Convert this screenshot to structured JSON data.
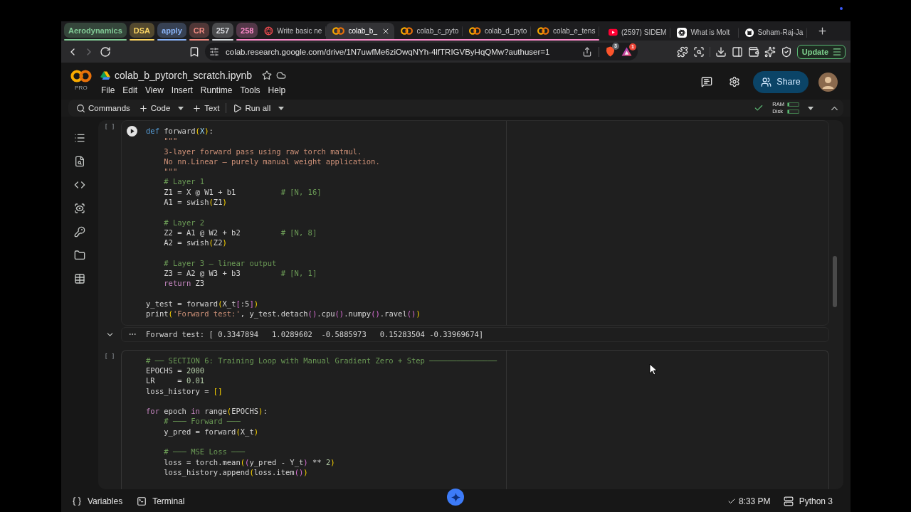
{
  "browser": {
    "tab_groups": [
      {
        "label": "Aerodynamics",
        "color": "#81c995"
      },
      {
        "label": "DSA",
        "color": "#fdd663"
      },
      {
        "label": "apply",
        "color": "#8ab4f8"
      },
      {
        "label": "CR",
        "color": "#f28b82"
      },
      {
        "label": "257",
        "color": "#dadce0"
      },
      {
        "label": "258",
        "color": "#ff8bcb",
        "tabs": [
          {
            "kind": "burst",
            "title": "Write basic ne",
            "selected": false
          },
          {
            "kind": "rings",
            "title": "colab_b_",
            "selected": true
          },
          {
            "kind": "rings",
            "title": "colab_c_pyto",
            "selected": false
          },
          {
            "kind": "rings",
            "title": "colab_d_pyto",
            "selected": false
          },
          {
            "kind": "rings",
            "title": "colab_e_tens",
            "selected": false
          }
        ]
      }
    ],
    "tabs": [
      {
        "kind": "play",
        "title": "(2597) SIDEM",
        "selected": false
      },
      {
        "kind": "knot",
        "title": "What is Molt",
        "selected": false
      },
      {
        "kind": "cat",
        "title": "Soham-Raj-Ja",
        "selected": false
      }
    ],
    "nav_buttons": [
      {
        "kind": "back",
        "disabled": false
      },
      {
        "kind": "forward",
        "disabled": true
      },
      {
        "kind": "reload",
        "disabled": false
      }
    ],
    "address": "colab.research.google.com/drive/1N7uwfMe6ziOwqNYh-4lfTRIGVByHqQMw?authuser=1",
    "extensions": [
      {
        "kind": "shield",
        "count": "3"
      },
      {
        "kind": "triangle",
        "count": "1"
      }
    ],
    "update_button": "Update"
  },
  "notebook": {
    "logo_badge": "PRO",
    "filename": "colab_b_pytorch_scratch.ipynb",
    "menu": [
      "File",
      "Edit",
      "View",
      "Insert",
      "Runtime",
      "Tools",
      "Help"
    ],
    "share_button": "Share",
    "toolbar": [
      {
        "kind": "search",
        "label": "Commands",
        "dropdown": false
      },
      {
        "kind": "add",
        "label": "Code",
        "dropdown": true
      },
      {
        "kind": "add",
        "label": "Text",
        "dropdown": false
      },
      {
        "kind": "run",
        "label": "Run all",
        "dropdown": true
      }
    ],
    "resources": {
      "connected": true,
      "meters": [
        {
          "label": "RAM",
          "level": 0.1
        },
        {
          "label": "Disk",
          "level": 0.1
        }
      ]
    },
    "cells": [
      {
        "prompt": "[ ]",
        "selected": true,
        "blocks": [
          {
            "lines": [
              [
                {
                  "kind": "keyword",
                  "text": "def"
                },
                {
                  "kind": "plain",
                  "text": " forward"
                },
                {
                  "kind": "paren",
                  "text": "("
                },
                {
                  "kind": "param",
                  "text": "X"
                },
                {
                  "kind": "paren",
                  "text": ")"
                },
                {
                  "kind": "plain",
                  "text": ":"
                }
              ],
              [
                {
                  "kind": "string",
                  "text": "    \"\"\""
                }
              ],
              [
                {
                  "kind": "string",
                  "text": "    3-layer forward pass using raw torch matmul."
                }
              ],
              [
                {
                  "kind": "string",
                  "text": "    No nn.Linear — purely manual weight application."
                }
              ],
              [
                {
                  "kind": "string",
                  "text": "    \"\"\""
                }
              ],
              [
                {
                  "kind": "comment",
                  "text": "    # Layer 1"
                }
              ],
              [
                {
                  "kind": "plain",
                  "text": "    Z1 = X @ W1 + b1          "
                },
                {
                  "kind": "comment",
                  "text": "# [N, 16]"
                }
              ],
              [
                {
                  "kind": "plain",
                  "text": "    A1 = swish"
                },
                {
                  "kind": "paren",
                  "text": "("
                },
                {
                  "kind": "plain",
                  "text": "Z1"
                },
                {
                  "kind": "paren",
                  "text": ")"
                }
              ]
            ]
          },
          {
            "lines": [
              [
                {
                  "kind": "comment",
                  "text": "    # Layer 2"
                }
              ],
              [
                {
                  "kind": "plain",
                  "text": "    Z2 = A1 @ W2 + b2         "
                },
                {
                  "kind": "comment",
                  "text": "# [N, 8]"
                }
              ],
              [
                {
                  "kind": "plain",
                  "text": "    A2 = swish"
                },
                {
                  "kind": "paren",
                  "text": "("
                },
                {
                  "kind": "plain",
                  "text": "Z2"
                },
                {
                  "kind": "paren",
                  "text": ")"
                }
              ]
            ]
          },
          {
            "lines": [
              [
                {
                  "kind": "comment",
                  "text": "    # Layer 3 — linear output"
                }
              ],
              [
                {
                  "kind": "plain",
                  "text": "    Z3 = A2 @ W3 + b3         "
                },
                {
                  "kind": "comment",
                  "text": "# [N, 1]"
                }
              ],
              [
                {
                  "kind": "control",
                  "text": "    return"
                },
                {
                  "kind": "plain",
                  "text": " Z3"
                }
              ]
            ]
          },
          {
            "lines": [
              [
                {
                  "kind": "plain",
                  "text": "y_test = forward"
                },
                {
                  "kind": "paren",
                  "text": "("
                },
                {
                  "kind": "plain",
                  "text": "X_t"
                },
                {
                  "kind": "bracket",
                  "text": "["
                },
                {
                  "kind": "plain",
                  "text": ":5"
                },
                {
                  "kind": "bracket",
                  "text": "]"
                },
                {
                  "kind": "paren",
                  "text": ")"
                }
              ],
              [
                {
                  "kind": "plain",
                  "text": "print"
                },
                {
                  "kind": "paren",
                  "text": "("
                },
                {
                  "kind": "string",
                  "text": "'Forward test:'"
                },
                {
                  "kind": "plain",
                  "text": ", y_test.detach"
                },
                {
                  "kind": "bracket",
                  "text": "()"
                },
                {
                  "kind": "plain",
                  "text": ".cpu"
                },
                {
                  "kind": "bracket",
                  "text": "()"
                },
                {
                  "kind": "plain",
                  "text": ".numpy"
                },
                {
                  "kind": "bracket",
                  "text": "()"
                },
                {
                  "kind": "plain",
                  "text": ".ravel"
                },
                {
                  "kind": "bracket",
                  "text": "()"
                },
                {
                  "kind": "paren",
                  "text": ")"
                }
              ]
            ]
          }
        ],
        "output": "Forward test: [ 0.3347894   1.0289602  -0.5885973   0.15283504 -0.33969674]"
      },
      {
        "prompt": "[ ]",
        "selected": false,
        "blocks": [
          {
            "lines": [
              [
                {
                  "kind": "comment",
                  "text": "# ── SECTION 6: Training Loop with Manual Gradient Zero + Step ───────────────"
                }
              ],
              [
                {
                  "kind": "plain",
                  "text": "EPOCHS = "
                },
                {
                  "kind": "number",
                  "text": "2000"
                }
              ],
              [
                {
                  "kind": "plain",
                  "text": "LR     = "
                },
                {
                  "kind": "number",
                  "text": "0.01"
                }
              ],
              [
                {
                  "kind": "plain",
                  "text": "loss_history = "
                },
                {
                  "kind": "paren",
                  "text": "[]"
                }
              ]
            ]
          },
          {
            "lines": [
              [
                {
                  "kind": "control",
                  "text": "for"
                },
                {
                  "kind": "plain",
                  "text": " epoch "
                },
                {
                  "kind": "control",
                  "text": "in"
                },
                {
                  "kind": "plain",
                  "text": " range"
                },
                {
                  "kind": "paren",
                  "text": "("
                },
                {
                  "kind": "plain",
                  "text": "EPOCHS"
                },
                {
                  "kind": "paren",
                  "text": ")"
                },
                {
                  "kind": "plain",
                  "text": ":"
                }
              ],
              [
                {
                  "kind": "comment",
                  "text": "    # ─── Forward ───"
                }
              ],
              [
                {
                  "kind": "plain",
                  "text": "    y_pred = forward"
                },
                {
                  "kind": "paren",
                  "text": "("
                },
                {
                  "kind": "plain",
                  "text": "X_t"
                },
                {
                  "kind": "paren",
                  "text": ")"
                }
              ]
            ]
          },
          {
            "lines": [
              [
                {
                  "kind": "comment",
                  "text": "    # ─── MSE Loss ───"
                }
              ],
              [
                {
                  "kind": "plain",
                  "text": "    loss = torch.mean"
                },
                {
                  "kind": "paren",
                  "text": "("
                },
                {
                  "kind": "bracket",
                  "text": "("
                },
                {
                  "kind": "plain",
                  "text": "y_pred - Y_t"
                },
                {
                  "kind": "bracket",
                  "text": ")"
                },
                {
                  "kind": "plain",
                  "text": " ** "
                },
                {
                  "kind": "number",
                  "text": "2"
                },
                {
                  "kind": "paren",
                  "text": ")"
                }
              ],
              [
                {
                  "kind": "plain",
                  "text": "    loss_history.append"
                },
                {
                  "kind": "paren",
                  "text": "("
                },
                {
                  "kind": "plain",
                  "text": "loss.item"
                },
                {
                  "kind": "bracket",
                  "text": "()"
                },
                {
                  "kind": "paren",
                  "text": ")"
                }
              ]
            ]
          }
        ]
      }
    ],
    "status_bar": {
      "panels": [
        {
          "kind": "variables",
          "label": "Variables"
        },
        {
          "kind": "terminal",
          "label": "Terminal"
        }
      ],
      "completed": true,
      "time": "8:33 PM",
      "runtime": "Python 3"
    }
  }
}
